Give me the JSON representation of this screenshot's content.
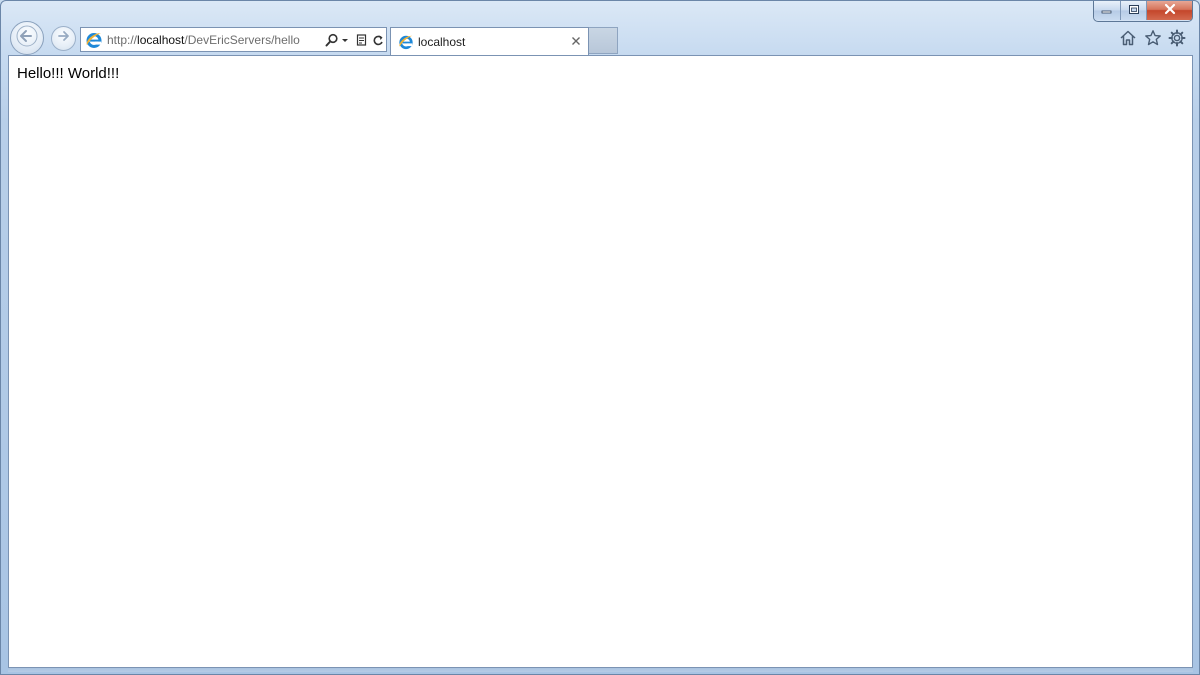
{
  "window": {
    "controls": {
      "minimize_icon": "minimize-icon",
      "maximize_icon": "restore-icon",
      "close_icon": "close-icon"
    }
  },
  "toolbar": {
    "back_icon": "back-arrow-icon",
    "forward_icon": "forward-arrow-icon",
    "address": {
      "protocol": "http://",
      "host": "localhost",
      "path": "/DevEricServers/hello"
    },
    "address_icons": [
      "search-icon",
      "dropdown-icon",
      "compatibility-view-icon",
      "refresh-icon"
    ],
    "command_icons": [
      "home-icon",
      "favorites-icon",
      "tools-icon"
    ]
  },
  "tabs": [
    {
      "title": "localhost",
      "active": true
    }
  ],
  "page": {
    "text": "Hello!!! World!!!"
  },
  "colors": {
    "frame": "#b9d1ea",
    "content_bg": "#ffffff",
    "close_button": "#c4462b",
    "ie_logo": "#1e88d8"
  }
}
